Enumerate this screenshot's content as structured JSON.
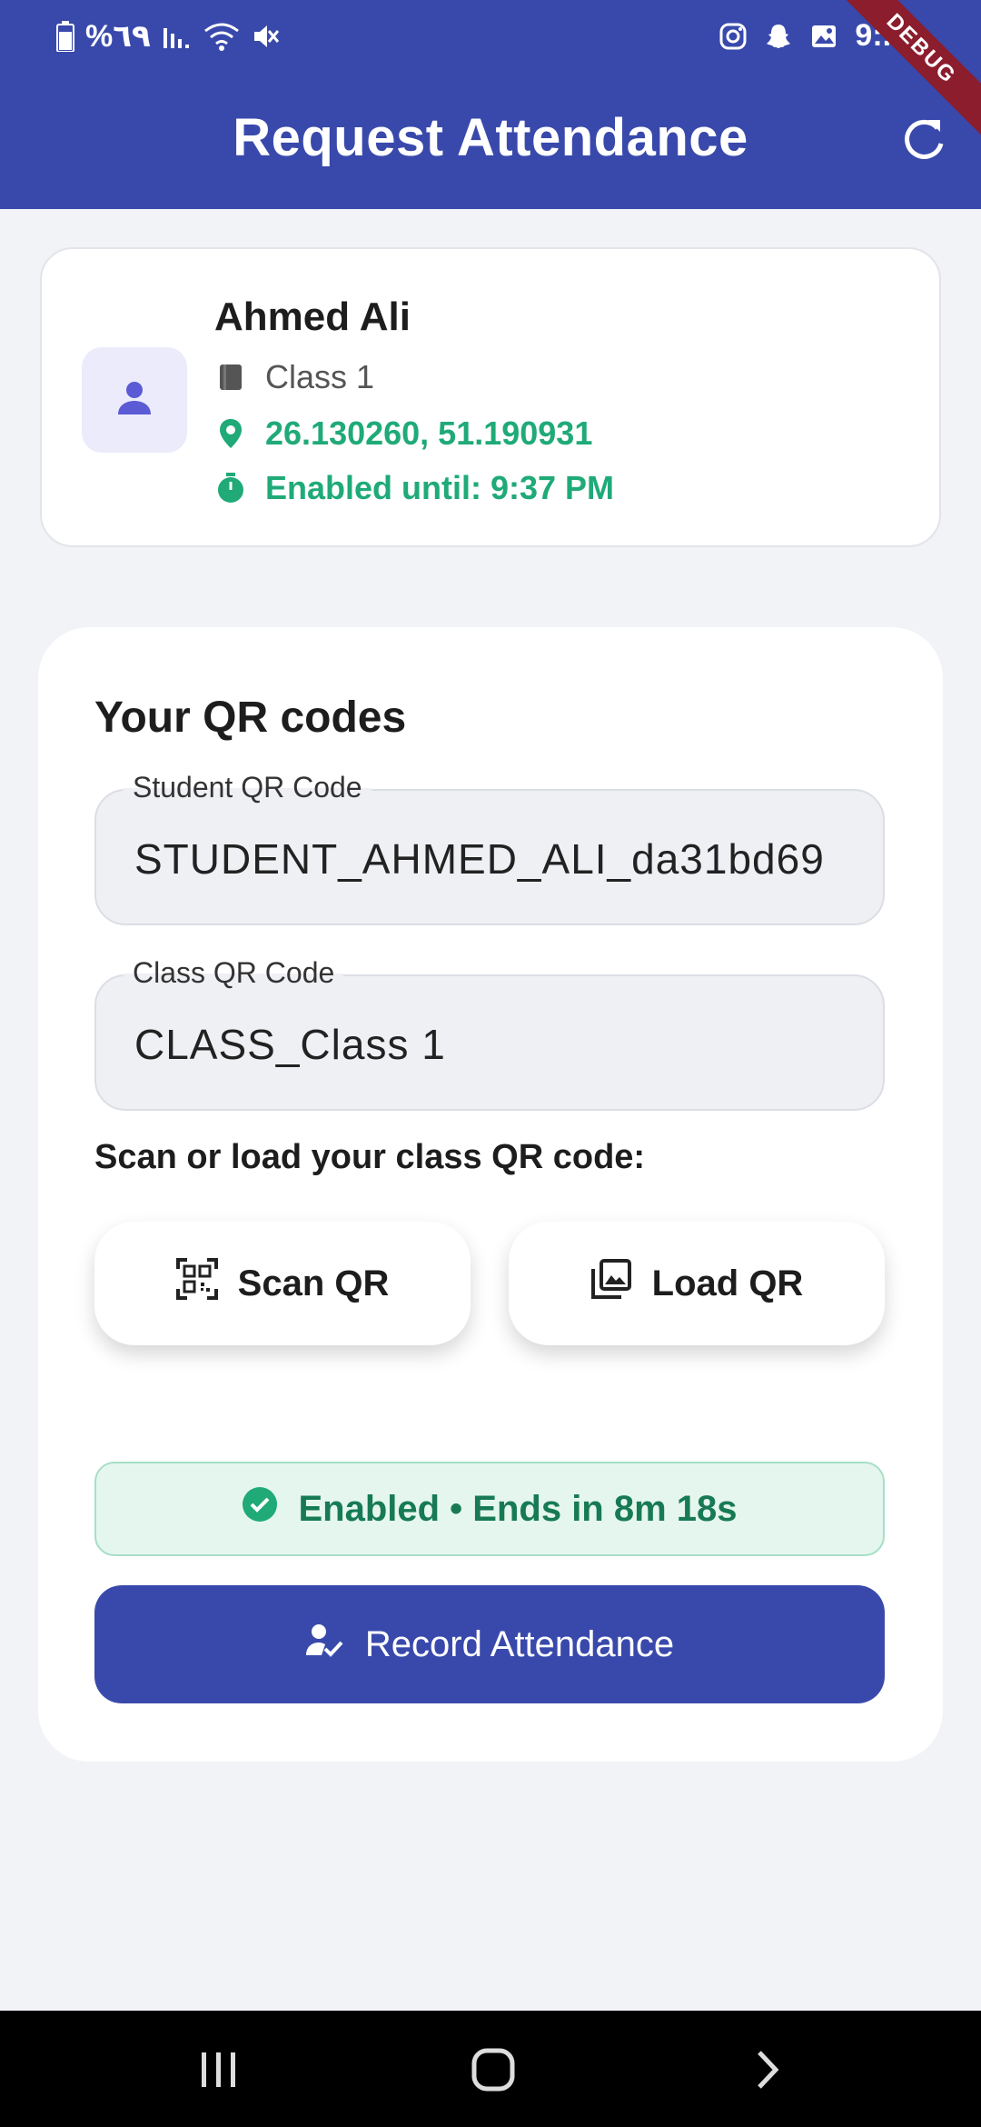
{
  "status_bar": {
    "battery_percent": "%٦٩",
    "time": "9:..."
  },
  "app_bar": {
    "title": "Request Attendance",
    "debug_banner": "DEBUG"
  },
  "profile": {
    "name": "Ahmed Ali",
    "class_name": "Class 1",
    "coordinates": "26.130260, 51.190931",
    "enabled_until": "Enabled until: 9:37 PM"
  },
  "qr_section": {
    "title": "Your QR codes",
    "student_field": {
      "label": "Student QR Code",
      "value": "STUDENT_AHMED_ALI_da31bd69"
    },
    "class_field": {
      "label": "Class QR Code",
      "value": "CLASS_Class 1"
    },
    "scan_prompt": "Scan or load your class QR code:",
    "scan_button": "Scan QR",
    "load_button": "Load QR",
    "status_text": "Enabled • Ends in 8m 18s",
    "record_button": "Record Attendance"
  },
  "colors": {
    "primary": "#3949ab",
    "success": "#1faa78",
    "status_bg": "#e5f6ef"
  },
  "icons": {
    "refresh": "refresh-icon",
    "avatar": "person-icon",
    "class": "book-icon",
    "location": "location-pin-icon",
    "timer": "timer-icon",
    "scan": "qr-scan-icon",
    "load": "image-library-icon",
    "check": "check-circle-icon",
    "record": "person-check-icon"
  }
}
